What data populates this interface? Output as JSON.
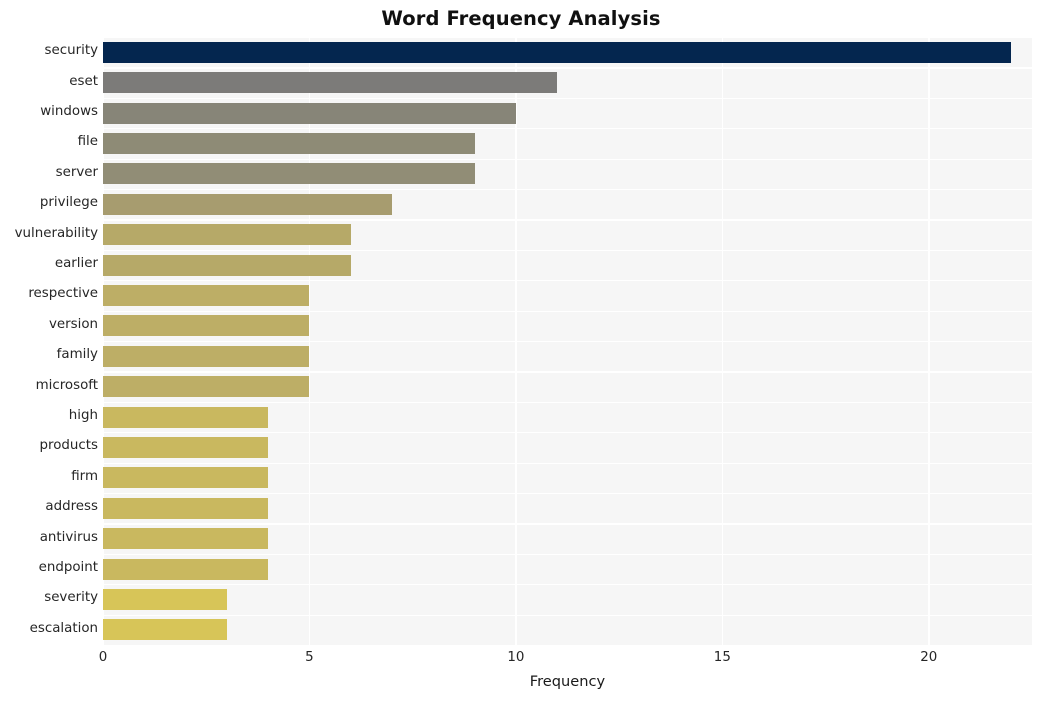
{
  "chart_data": {
    "type": "bar",
    "orientation": "horizontal",
    "title": "Word Frequency Analysis",
    "xlabel": "Frequency",
    "ylabel": "",
    "xlim": [
      0,
      22.5
    ],
    "xticks": [
      0,
      5,
      10,
      15,
      20
    ],
    "xtick_labels": [
      "0",
      "5",
      "10",
      "15",
      "20"
    ],
    "grid": true,
    "grid_color": "#ffffff",
    "plot_background": "#f6f6f6",
    "figure_background": "#ffffff",
    "legend": null,
    "categories": [
      "security",
      "eset",
      "windows",
      "file",
      "server",
      "privilege",
      "vulnerability",
      "earlier",
      "respective",
      "version",
      "family",
      "microsoft",
      "high",
      "products",
      "firm",
      "address",
      "antivirus",
      "endpoint",
      "severity",
      "escalation"
    ],
    "values": [
      22,
      11,
      10,
      9,
      9,
      7,
      6,
      6,
      5,
      5,
      5,
      5,
      4,
      4,
      4,
      4,
      4,
      4,
      3,
      3
    ],
    "bar_colors": [
      "#04264f",
      "#7c7b79",
      "#878578",
      "#8e8b76",
      "#918d76",
      "#a79c6f",
      "#b6a968",
      "#b6a968",
      "#bdae66",
      "#bdae66",
      "#bdae66",
      "#bdae66",
      "#c9b85f",
      "#c9b85f",
      "#c9b85f",
      "#c9b85f",
      "#c9b85f",
      "#c9b85f",
      "#d7c558",
      "#d7c558"
    ]
  }
}
